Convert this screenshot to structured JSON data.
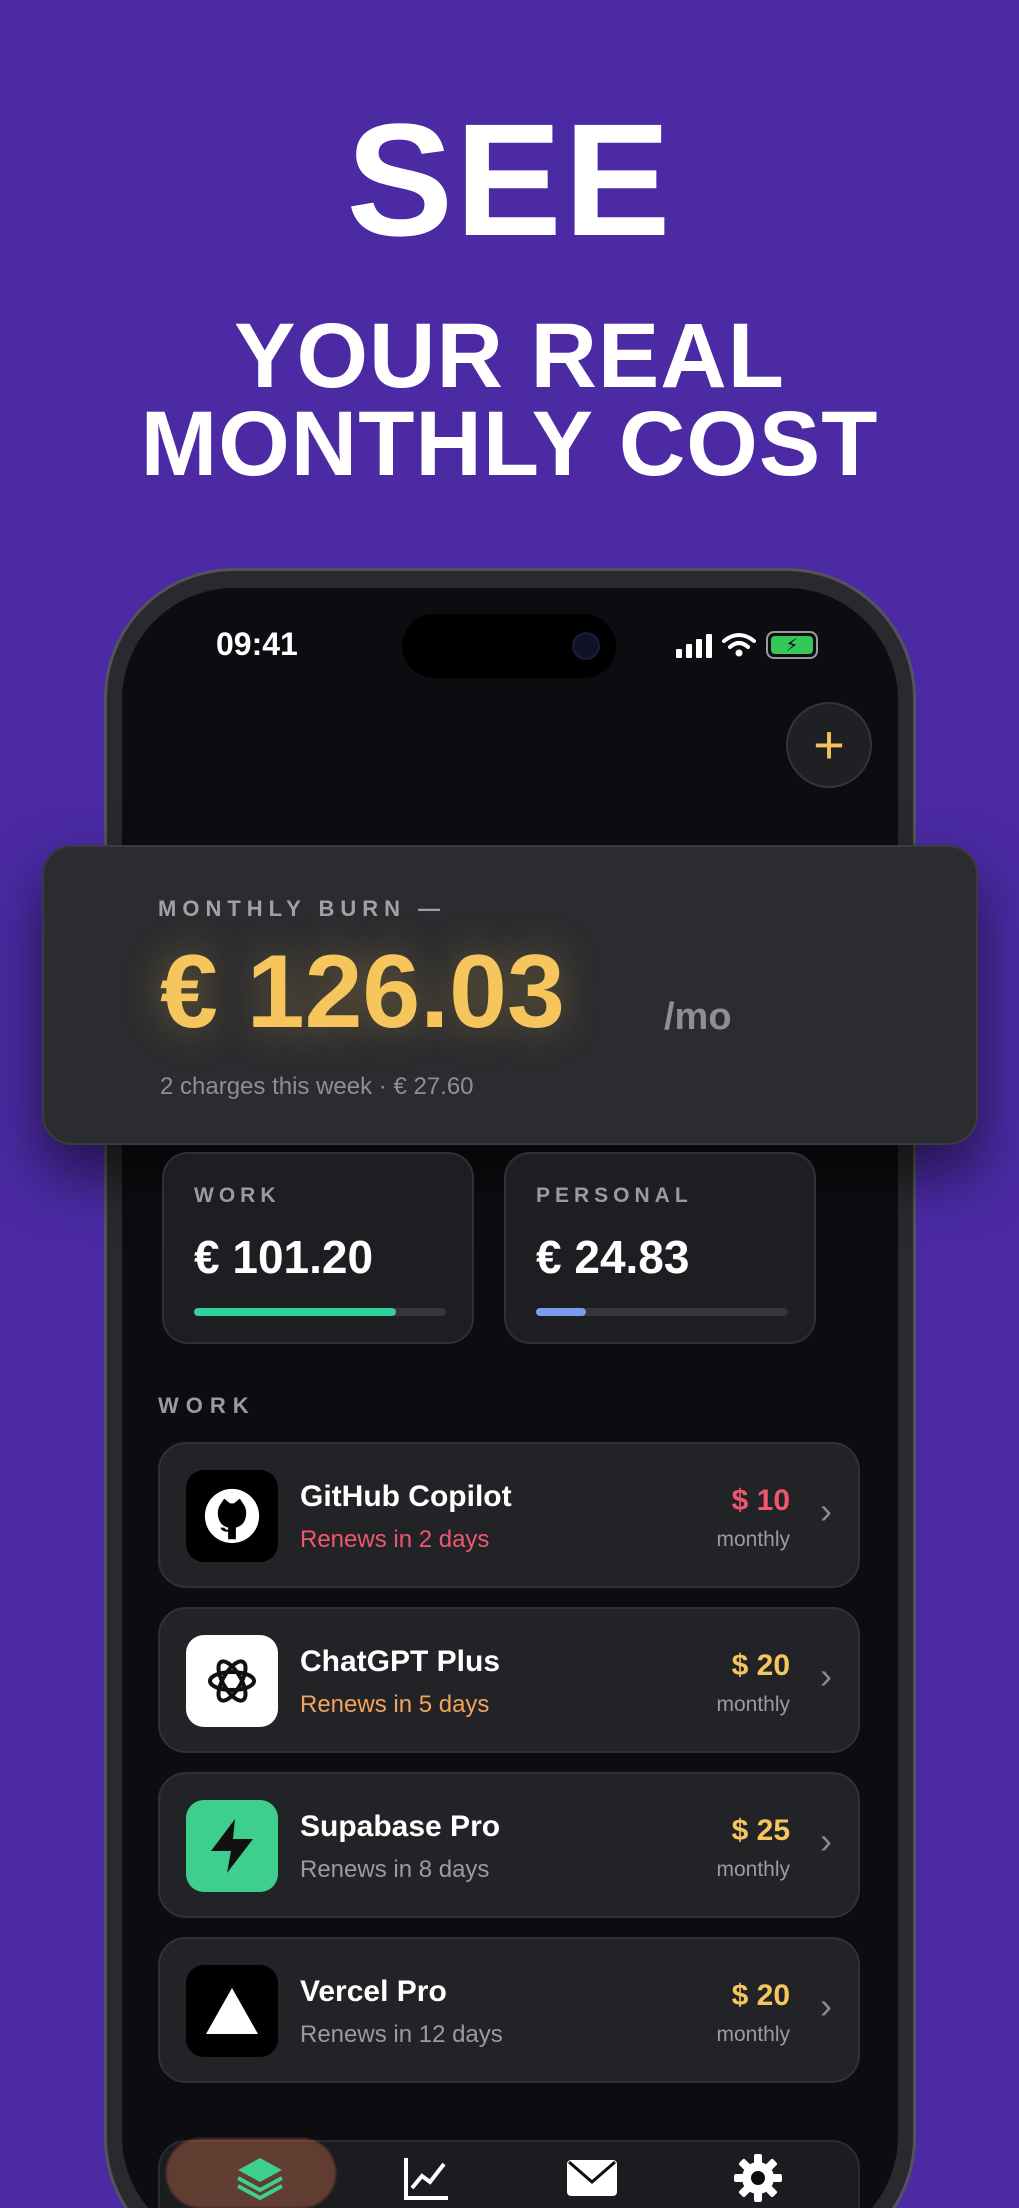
{
  "headline": {
    "line1": "SEE",
    "line2": "YOUR REAL",
    "line3": "MONTHLY COST"
  },
  "status_bar": {
    "time": "09:41"
  },
  "burn": {
    "label": "MONTHLY BURN —",
    "amount": "€ 126.03",
    "unit": "/mo",
    "subtitle": "2 charges this week · € 27.60"
  },
  "splits": [
    {
      "label": "WORK",
      "amount": "€ 101.20",
      "progress": 0.8,
      "color": "#2ed39a"
    },
    {
      "label": "PERSONAL",
      "amount": "€ 24.83",
      "progress": 0.2,
      "color": "#7c9cf0"
    }
  ],
  "section": {
    "label": "WORK"
  },
  "subscriptions": [
    {
      "name": "GitHub Copilot",
      "renew": "Renews in 2 days",
      "renew_color": "#f0566e",
      "price": "$ 10",
      "price_color": "#f0566e",
      "cycle": "monthly",
      "icon": "github-icon"
    },
    {
      "name": "ChatGPT Plus",
      "renew": "Renews in 5 days",
      "renew_color": "#f4a25a",
      "price": "$ 20",
      "price_color": "#f6c65c",
      "cycle": "monthly",
      "icon": "openai-icon"
    },
    {
      "name": "Supabase Pro",
      "renew": "Renews in 8 days",
      "renew_color": "#9a9aa0",
      "price": "$ 25",
      "price_color": "#f6c65c",
      "cycle": "monthly",
      "icon": "supabase-bolt-icon"
    },
    {
      "name": "Vercel Pro",
      "renew": "Renews in 12 days",
      "renew_color": "#9a9aa0",
      "price": "$ 20",
      "price_color": "#f6c65c",
      "cycle": "monthly",
      "icon": "vercel-triangle-icon"
    }
  ],
  "tabs": [
    {
      "name": "subscriptions-tab",
      "icon": "layers-icon"
    },
    {
      "name": "insights-tab",
      "icon": "chart-icon"
    },
    {
      "name": "inbox-tab",
      "icon": "mail-icon"
    },
    {
      "name": "settings-tab",
      "icon": "gear-icon"
    }
  ],
  "colors": {
    "background": "#4b2aa3",
    "accent": "#f6c65c"
  }
}
